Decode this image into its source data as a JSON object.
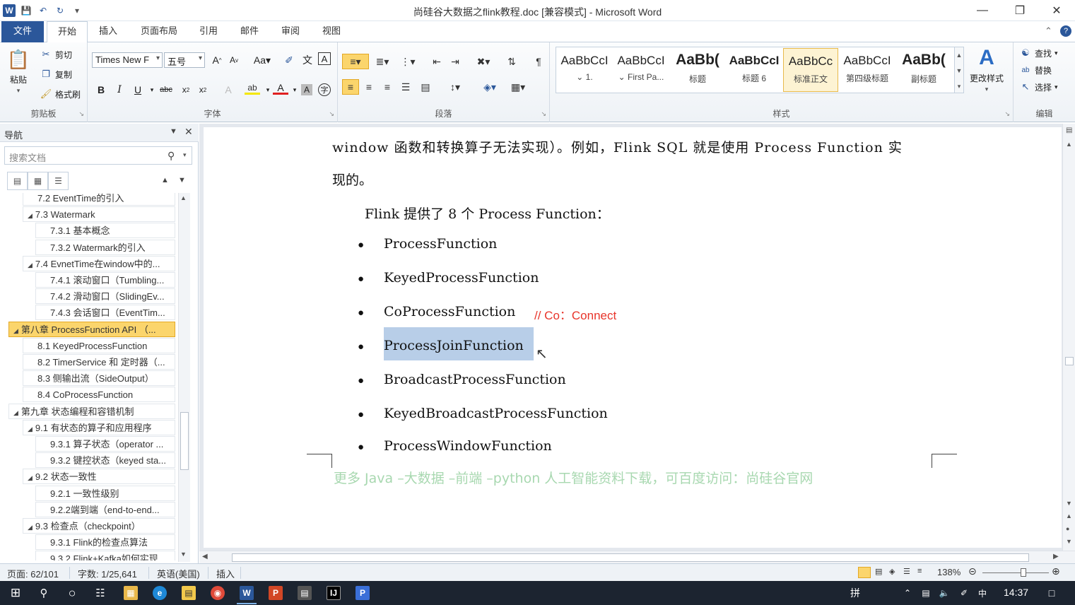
{
  "titlebar": {
    "title": "尚硅谷大数据之flink教程.doc [兼容模式] - Microsoft Word",
    "app_icon": "W",
    "quick_access": [
      "save-icon",
      "undo-icon",
      "redo-icon",
      "customize-icon"
    ]
  },
  "tabs": {
    "file": "文件",
    "items": [
      "开始",
      "插入",
      "页面布局",
      "引用",
      "邮件",
      "审阅",
      "视图"
    ],
    "active": "开始"
  },
  "ribbon": {
    "clipboard": {
      "paste": "粘贴",
      "cut": "剪切",
      "copy": "复制",
      "format_painter": "格式刷",
      "label": "剪贴板"
    },
    "font": {
      "family": "Times New F",
      "size": "五号",
      "label": "字体"
    },
    "paragraph": {
      "label": "段落"
    },
    "styles": {
      "label": "样式",
      "items": [
        {
          "sample": "AaBbCcI",
          "name": "⌄ 1."
        },
        {
          "sample": "AaBbCcI",
          "name": "⌄ First Pa..."
        },
        {
          "sample": "AaBb(",
          "name": "标题"
        },
        {
          "sample": "AaBbCcI",
          "name": "标题 6"
        },
        {
          "sample": "AaBbCc",
          "name": "标准正文"
        },
        {
          "sample": "AaBbCcI",
          "name": "第四级标题"
        },
        {
          "sample": "AaBb(",
          "name": "副标题"
        }
      ],
      "change_styles": "更改样式"
    },
    "editing": {
      "find": "查找",
      "replace": "替换",
      "select": "选择",
      "label": "编辑"
    }
  },
  "nav": {
    "title": "导航",
    "search_placeholder": "搜索文档",
    "items": [
      {
        "text": "7.2 EventTime的引入",
        "level": 2,
        "expand": false
      },
      {
        "text": "7.3 Watermark",
        "level": 2,
        "expand": true
      },
      {
        "text": "7.3.1 基本概念",
        "level": 3,
        "expand": false
      },
      {
        "text": "7.3.2 Watermark的引入",
        "level": 3,
        "expand": false
      },
      {
        "text": "7.4 EvnetTime在window中的...",
        "level": 2,
        "expand": true
      },
      {
        "text": "7.4.1 滚动窗口（Tumbling...",
        "level": 3,
        "expand": false
      },
      {
        "text": "7.4.2 滑动窗口（SlidingEv...",
        "level": 3,
        "expand": false
      },
      {
        "text": "7.4.3 会话窗口（EventTim...",
        "level": 3,
        "expand": false
      },
      {
        "text": "第八章 ProcessFunction API （...",
        "level": 1,
        "expand": true,
        "selected": true
      },
      {
        "text": "8.1 KeyedProcessFunction",
        "level": 2,
        "expand": false
      },
      {
        "text": "8.2 TimerService 和 定时器（...",
        "level": 2,
        "expand": false
      },
      {
        "text": "8.3 侧输出流（SideOutput）",
        "level": 2,
        "expand": false
      },
      {
        "text": "8.4 CoProcessFunction",
        "level": 2,
        "expand": false
      },
      {
        "text": "第九章 状态编程和容错机制",
        "level": 1,
        "expand": true
      },
      {
        "text": "9.1 有状态的算子和应用程序",
        "level": 2,
        "expand": true
      },
      {
        "text": "9.3.1 算子状态（operator ...",
        "level": 3,
        "expand": false
      },
      {
        "text": "9.3.2 键控状态（keyed sta...",
        "level": 3,
        "expand": false
      },
      {
        "text": "9.2 状态一致性",
        "level": 2,
        "expand": true
      },
      {
        "text": "9.2.1 一致性级别",
        "level": 3,
        "expand": false
      },
      {
        "text": "9.2.2端到端（end-to-end...",
        "level": 3,
        "expand": false
      },
      {
        "text": "9.3 检查点（checkpoint）",
        "level": 2,
        "expand": true
      },
      {
        "text": "9.3.1 Flink的检查点算法",
        "level": 3,
        "expand": false
      },
      {
        "text": "9.3.2 Flink+Kafka如何实现...",
        "level": 3,
        "expand": false
      }
    ]
  },
  "document": {
    "line1": "window 函数和转换算子无法实现）。例如，Flink SQL 就是使用 Process Function 实",
    "line2": "现的。",
    "intro": "Flink 提供了 8 个 Process Function：",
    "bullets": [
      "ProcessFunction",
      "KeyedProcessFunction",
      "CoProcessFunction",
      "ProcessJoinFunction",
      "BroadcastProcessFunction",
      "KeyedBroadcastProcessFunction",
      "ProcessWindowFunction"
    ],
    "comment": "// Co：Connect",
    "footer": "更多 Java –大数据 –前端 –python 人工智能资料下载，可百度访问：尚硅谷官网"
  },
  "statusbar": {
    "page": "页面: 62/101",
    "words": "字数: 1/25,641",
    "language": "英语(美国)",
    "mode": "插入",
    "zoom": "138%"
  },
  "taskbar": {
    "time": "14:37",
    "ime": "拼"
  }
}
